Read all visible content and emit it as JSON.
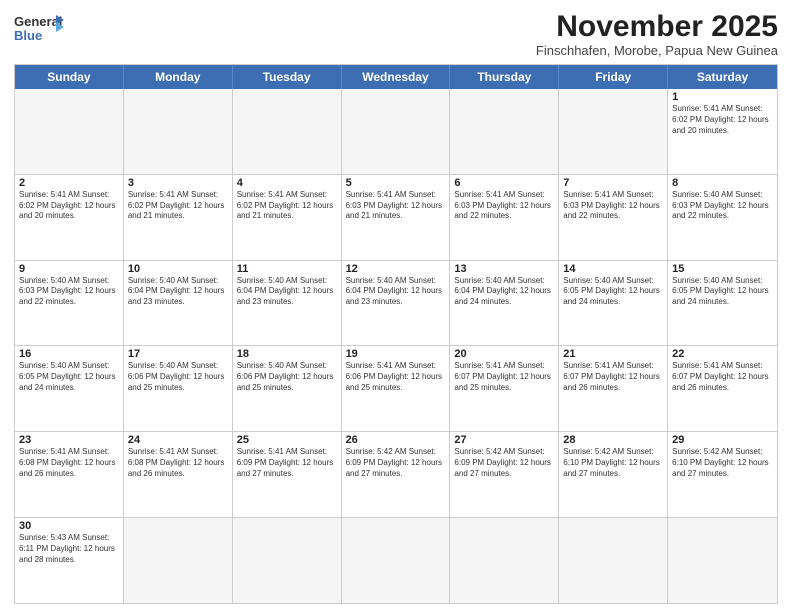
{
  "logo": {
    "line1": "General",
    "line2": "Blue"
  },
  "title": "November 2025",
  "subtitle": "Finschhafen, Morobe, Papua New Guinea",
  "header_days": [
    "Sunday",
    "Monday",
    "Tuesday",
    "Wednesday",
    "Thursday",
    "Friday",
    "Saturday"
  ],
  "weeks": [
    [
      {
        "day": "",
        "info": "",
        "empty": true
      },
      {
        "day": "",
        "info": "",
        "empty": true
      },
      {
        "day": "",
        "info": "",
        "empty": true
      },
      {
        "day": "",
        "info": "",
        "empty": true
      },
      {
        "day": "",
        "info": "",
        "empty": true
      },
      {
        "day": "",
        "info": "",
        "empty": true
      },
      {
        "day": "1",
        "info": "Sunrise: 5:41 AM\nSunset: 6:02 PM\nDaylight: 12 hours\nand 20 minutes.",
        "empty": false
      }
    ],
    [
      {
        "day": "2",
        "info": "Sunrise: 5:41 AM\nSunset: 6:02 PM\nDaylight: 12 hours\nand 20 minutes.",
        "empty": false
      },
      {
        "day": "3",
        "info": "Sunrise: 5:41 AM\nSunset: 6:02 PM\nDaylight: 12 hours\nand 21 minutes.",
        "empty": false
      },
      {
        "day": "4",
        "info": "Sunrise: 5:41 AM\nSunset: 6:02 PM\nDaylight: 12 hours\nand 21 minutes.",
        "empty": false
      },
      {
        "day": "5",
        "info": "Sunrise: 5:41 AM\nSunset: 6:03 PM\nDaylight: 12 hours\nand 21 minutes.",
        "empty": false
      },
      {
        "day": "6",
        "info": "Sunrise: 5:41 AM\nSunset: 6:03 PM\nDaylight: 12 hours\nand 22 minutes.",
        "empty": false
      },
      {
        "day": "7",
        "info": "Sunrise: 5:41 AM\nSunset: 6:03 PM\nDaylight: 12 hours\nand 22 minutes.",
        "empty": false
      },
      {
        "day": "8",
        "info": "Sunrise: 5:40 AM\nSunset: 6:03 PM\nDaylight: 12 hours\nand 22 minutes.",
        "empty": false
      }
    ],
    [
      {
        "day": "9",
        "info": "Sunrise: 5:40 AM\nSunset: 6:03 PM\nDaylight: 12 hours\nand 22 minutes.",
        "empty": false
      },
      {
        "day": "10",
        "info": "Sunrise: 5:40 AM\nSunset: 6:04 PM\nDaylight: 12 hours\nand 23 minutes.",
        "empty": false
      },
      {
        "day": "11",
        "info": "Sunrise: 5:40 AM\nSunset: 6:04 PM\nDaylight: 12 hours\nand 23 minutes.",
        "empty": false
      },
      {
        "day": "12",
        "info": "Sunrise: 5:40 AM\nSunset: 6:04 PM\nDaylight: 12 hours\nand 23 minutes.",
        "empty": false
      },
      {
        "day": "13",
        "info": "Sunrise: 5:40 AM\nSunset: 6:04 PM\nDaylight: 12 hours\nand 24 minutes.",
        "empty": false
      },
      {
        "day": "14",
        "info": "Sunrise: 5:40 AM\nSunset: 6:05 PM\nDaylight: 12 hours\nand 24 minutes.",
        "empty": false
      },
      {
        "day": "15",
        "info": "Sunrise: 5:40 AM\nSunset: 6:05 PM\nDaylight: 12 hours\nand 24 minutes.",
        "empty": false
      }
    ],
    [
      {
        "day": "16",
        "info": "Sunrise: 5:40 AM\nSunset: 6:05 PM\nDaylight: 12 hours\nand 24 minutes.",
        "empty": false
      },
      {
        "day": "17",
        "info": "Sunrise: 5:40 AM\nSunset: 6:06 PM\nDaylight: 12 hours\nand 25 minutes.",
        "empty": false
      },
      {
        "day": "18",
        "info": "Sunrise: 5:40 AM\nSunset: 6:06 PM\nDaylight: 12 hours\nand 25 minutes.",
        "empty": false
      },
      {
        "day": "19",
        "info": "Sunrise: 5:41 AM\nSunset: 6:06 PM\nDaylight: 12 hours\nand 25 minutes.",
        "empty": false
      },
      {
        "day": "20",
        "info": "Sunrise: 5:41 AM\nSunset: 6:07 PM\nDaylight: 12 hours\nand 25 minutes.",
        "empty": false
      },
      {
        "day": "21",
        "info": "Sunrise: 5:41 AM\nSunset: 6:07 PM\nDaylight: 12 hours\nand 26 minutes.",
        "empty": false
      },
      {
        "day": "22",
        "info": "Sunrise: 5:41 AM\nSunset: 6:07 PM\nDaylight: 12 hours\nand 26 minutes.",
        "empty": false
      }
    ],
    [
      {
        "day": "23",
        "info": "Sunrise: 5:41 AM\nSunset: 6:08 PM\nDaylight: 12 hours\nand 26 minutes.",
        "empty": false
      },
      {
        "day": "24",
        "info": "Sunrise: 5:41 AM\nSunset: 6:08 PM\nDaylight: 12 hours\nand 26 minutes.",
        "empty": false
      },
      {
        "day": "25",
        "info": "Sunrise: 5:41 AM\nSunset: 6:09 PM\nDaylight: 12 hours\nand 27 minutes.",
        "empty": false
      },
      {
        "day": "26",
        "info": "Sunrise: 5:42 AM\nSunset: 6:09 PM\nDaylight: 12 hours\nand 27 minutes.",
        "empty": false
      },
      {
        "day": "27",
        "info": "Sunrise: 5:42 AM\nSunset: 6:09 PM\nDaylight: 12 hours\nand 27 minutes.",
        "empty": false
      },
      {
        "day": "28",
        "info": "Sunrise: 5:42 AM\nSunset: 6:10 PM\nDaylight: 12 hours\nand 27 minutes.",
        "empty": false
      },
      {
        "day": "29",
        "info": "Sunrise: 5:42 AM\nSunset: 6:10 PM\nDaylight: 12 hours\nand 27 minutes.",
        "empty": false
      }
    ],
    [
      {
        "day": "30",
        "info": "Sunrise: 5:43 AM\nSunset: 6:11 PM\nDaylight: 12 hours\nand 28 minutes.",
        "empty": false
      },
      {
        "day": "",
        "info": "",
        "empty": true
      },
      {
        "day": "",
        "info": "",
        "empty": true
      },
      {
        "day": "",
        "info": "",
        "empty": true
      },
      {
        "day": "",
        "info": "",
        "empty": true
      },
      {
        "day": "",
        "info": "",
        "empty": true
      },
      {
        "day": "",
        "info": "",
        "empty": true
      }
    ]
  ]
}
